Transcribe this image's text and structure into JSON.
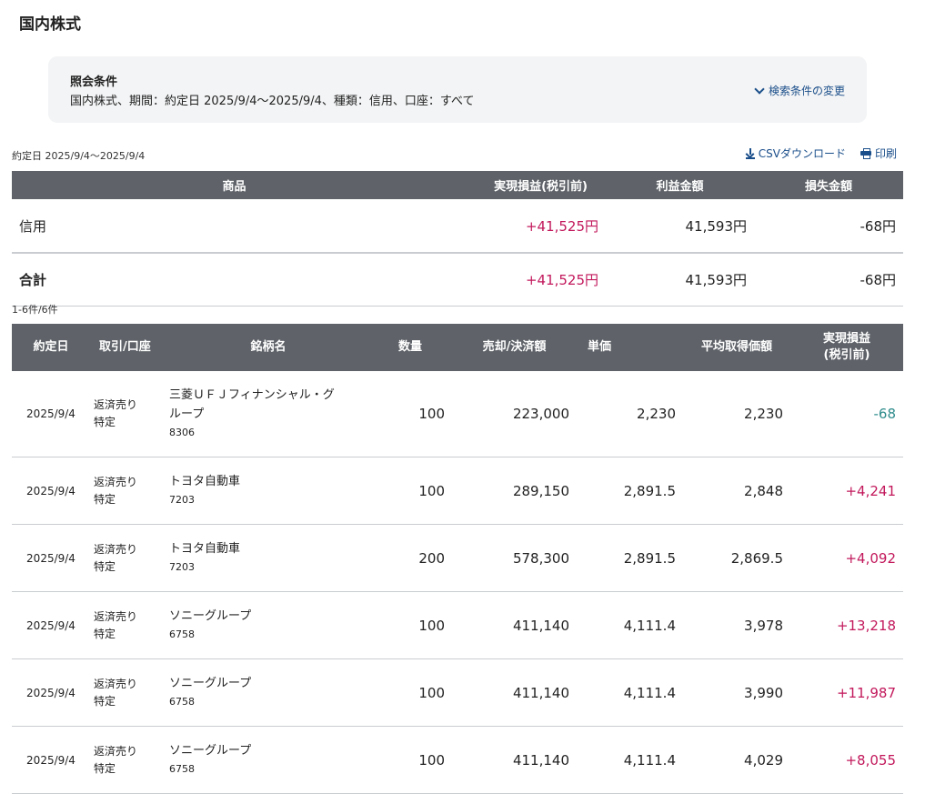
{
  "page_title": "国内株式",
  "conditions": {
    "title": "照会条件",
    "text": "国内株式、期間：約定日 2025/9/4〜2025/9/4、種類：信用、口座：すべて",
    "change_link": "検索条件の変更"
  },
  "period_label": "約定日 2025/9/4〜2025/9/4",
  "actions": {
    "csv": "CSVダウンロード",
    "print": "印刷"
  },
  "summary": {
    "headers": [
      "商品",
      "実現損益(税引前)",
      "利益金額",
      "損失金額"
    ],
    "rows": [
      {
        "label": "信用",
        "pnl": "+41,525円",
        "profit": "41,593円",
        "loss": "-68円"
      },
      {
        "label": "合計",
        "pnl": "+41,525円",
        "profit": "41,593円",
        "loss": "-68円"
      }
    ]
  },
  "count_label": "1-6件/6件",
  "detail": {
    "headers": [
      "約定日",
      "取引/口座",
      "銘柄名",
      "数量",
      "売却/決済額",
      "単価",
      "平均取得価額",
      "実現損益",
      "(税引前)"
    ],
    "rows": [
      {
        "date": "2025/9/4",
        "trade": "返済売り",
        "account": "特定",
        "name1": "三菱ＵＦＪフィナンシャル・グ",
        "name2": "ループ",
        "code": "8306",
        "qty": "100",
        "amount": "223,000",
        "price": "2,230",
        "avg": "2,230",
        "pnl": "-68"
      },
      {
        "date": "2025/9/4",
        "trade": "返済売り",
        "account": "特定",
        "name1": "トヨタ自動車",
        "code": "7203",
        "qty": "100",
        "amount": "289,150",
        "price": "2,891.5",
        "avg": "2,848",
        "pnl": "+4,241"
      },
      {
        "date": "2025/9/4",
        "trade": "返済売り",
        "account": "特定",
        "name1": "トヨタ自動車",
        "code": "7203",
        "qty": "200",
        "amount": "578,300",
        "price": "2,891.5",
        "avg": "2,869.5",
        "pnl": "+4,092"
      },
      {
        "date": "2025/9/4",
        "trade": "返済売り",
        "account": "特定",
        "name1": "ソニーグループ",
        "code": "6758",
        "qty": "100",
        "amount": "411,140",
        "price": "4,111.4",
        "avg": "3,978",
        "pnl": "+13,218"
      },
      {
        "date": "2025/9/4",
        "trade": "返済売り",
        "account": "特定",
        "name1": "ソニーグループ",
        "code": "6758",
        "qty": "100",
        "amount": "411,140",
        "price": "4,111.4",
        "avg": "3,990",
        "pnl": "+11,987"
      },
      {
        "date": "2025/9/4",
        "trade": "返済売り",
        "account": "特定",
        "name1": "ソニーグループ",
        "code": "6758",
        "qty": "100",
        "amount": "411,140",
        "price": "4,111.4",
        "avg": "4,029",
        "pnl": "+8,055"
      }
    ]
  },
  "colors": {
    "header_bg": "#5f6369",
    "positive": "#c2185b",
    "negative": "#2e8b8b",
    "link": "#1a4e8a"
  }
}
